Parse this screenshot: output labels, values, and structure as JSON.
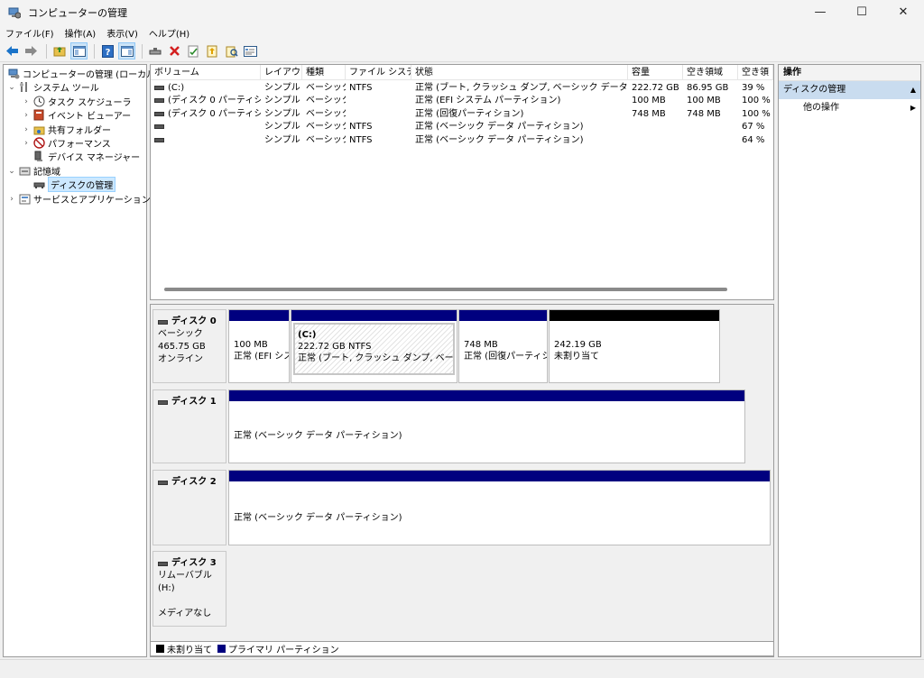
{
  "window": {
    "title": "コンピューターの管理",
    "min_glyph": "—",
    "max_glyph": "☐",
    "close_glyph": "✕"
  },
  "menu": [
    "ファイル(F)",
    "操作(A)",
    "表示(V)",
    "ヘルプ(H)"
  ],
  "toolbar": {
    "buttons": [
      "back-icon",
      "forward-icon",
      "up-folder-icon",
      "show-tree-icon",
      "help-icon",
      "show-action-pane-icon",
      "connect-drive-icon",
      "delete-icon",
      "check-icon",
      "folder-up-icon",
      "search-folder-icon",
      "properties-icon"
    ]
  },
  "tree": {
    "root": "コンピューターの管理 (ローカル)",
    "system_tools": "システム ツール",
    "task_scheduler": "タスク スケジューラ",
    "event_viewer": "イベント ビューアー",
    "shared_folders": "共有フォルダー",
    "performance": "パフォーマンス",
    "device_manager": "デバイス マネージャー",
    "storage": "記憶域",
    "disk_management": "ディスクの管理",
    "services_apps": "サービスとアプリケーション"
  },
  "volume_list": {
    "headers": [
      "ボリューム",
      "レイアウト",
      "種類",
      "ファイル システム",
      "状態",
      "容量",
      "空き領域",
      "空き領"
    ],
    "rows": [
      [
        "(C:)",
        "シンプル",
        "ベーシック",
        "NTFS",
        "正常 (ブート, クラッシュ ダンプ, ベーシック データ パーティション)",
        "222.72 GB",
        "86.95 GB",
        "39 %"
      ],
      [
        "(ディスク 0 パーティション 1)",
        "シンプル",
        "ベーシック",
        "",
        "正常 (EFI システム パーティション)",
        "100 MB",
        "100 MB",
        "100 %"
      ],
      [
        "(ディスク 0 パーティション 4)",
        "シンプル",
        "ベーシック",
        "",
        "正常 (回復パーティション)",
        "748 MB",
        "748 MB",
        "100 %"
      ],
      [
        "",
        "シンプル",
        "ベーシック",
        "NTFS",
        "正常 (ベーシック データ パーティション)",
        "",
        "",
        "67 %"
      ],
      [
        "",
        "シンプル",
        "ベーシック",
        "NTFS",
        "正常 (ベーシック データ パーティション)",
        "",
        "",
        "64 %"
      ]
    ]
  },
  "disks": {
    "disk0": {
      "name": "ディスク 0",
      "type": "ベーシック",
      "size": "465.75 GB",
      "status": "オンライン",
      "p1_size": "100 MB",
      "p1_status": "正常 (EFI シス",
      "p2_name": "(C:)",
      "p2_size": "222.72 GB NTFS",
      "p2_status": "正常 (ブート, クラッシュ ダンプ, ベーシック デー",
      "p3_size": "748 MB",
      "p3_status": "正常 (回復パーティショ",
      "p4_size": "242.19 GB",
      "p4_status": "未割り当て"
    },
    "disk1": {
      "name": "ディスク 1",
      "p1_status": "正常 (ベーシック データ パーティション)"
    },
    "disk2": {
      "name": "ディスク 2",
      "p1_status": "正常 (ベーシック データ パーティション)"
    },
    "disk3": {
      "name": "ディスク 3",
      "type": "リムーバブル (H:)",
      "status": "メディアなし"
    }
  },
  "legend": {
    "unallocated": "未割り当て",
    "primary": "プライマリ パーティション"
  },
  "actions": {
    "header": "操作",
    "section": "ディスクの管理",
    "other": "他の操作"
  },
  "colors": {
    "primary_partition": "#00007f",
    "unallocated": "#000000",
    "selection": "#cce8ff"
  }
}
